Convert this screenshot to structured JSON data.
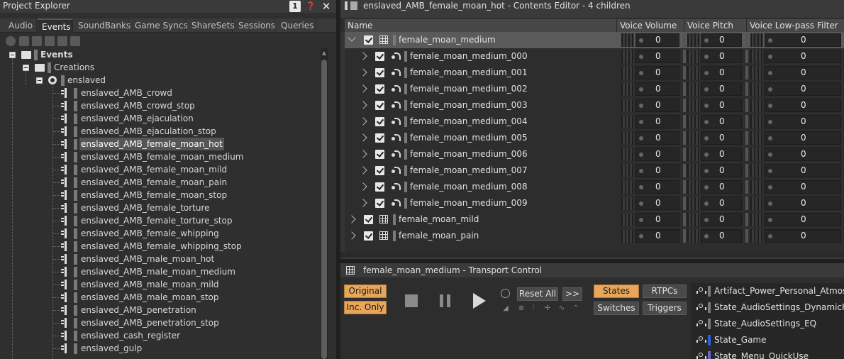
{
  "project_explorer": {
    "title": "Project Explorer",
    "badge": "1",
    "tabs": [
      {
        "label": "Audio"
      },
      {
        "label": "Events"
      },
      {
        "label": "SoundBanks"
      },
      {
        "label": "Game Syncs"
      },
      {
        "label": "ShareSets"
      },
      {
        "label": "Sessions"
      },
      {
        "label": "Queries"
      }
    ],
    "active_tab": "Events",
    "tree": {
      "root": "Events",
      "folder": "Creations",
      "workunit": "enslaved",
      "selected": "enslaved_AMB_female_moan_hot",
      "events": [
        "enslaved_AMB_crowd",
        "enslaved_AMB_crowd_stop",
        "enslaved_AMB_ejaculation",
        "enslaved_AMB_ejaculation_stop",
        "enslaved_AMB_female_moan_hot",
        "enslaved_AMB_female_moan_medium",
        "enslaved_AMB_female_moan_mild",
        "enslaved_AMB_female_moan_pain",
        "enslaved_AMB_female_moan_stop",
        "enslaved_AMB_female_torture",
        "enslaved_AMB_female_torture_stop",
        "enslaved_AMB_female_whipping",
        "enslaved_AMB_female_whipping_stop",
        "enslaved_AMB_male_moan_hot",
        "enslaved_AMB_male_moan_medium",
        "enslaved_AMB_male_moan_mild",
        "enslaved_AMB_male_moan_stop",
        "enslaved_AMB_penetration",
        "enslaved_AMB_penetration_stop",
        "enslaved_cash_register",
        "enslaved_gulp"
      ]
    }
  },
  "contents_editor": {
    "title": "enslaved_AMB_female_moan_hot - Contents Editor - 4 children",
    "columns": [
      "Name",
      "Voice Volume",
      "Voice Pitch",
      "Voice Low-pass Filter"
    ],
    "rows": [
      {
        "name": "female_moan_medium",
        "level": 0,
        "type": "container",
        "expanded": true,
        "selected": true,
        "volume": "0",
        "pitch": "0",
        "lpf": "0"
      },
      {
        "name": "female_moan_medium_000",
        "level": 1,
        "type": "sound",
        "volume": "0",
        "pitch": "0",
        "lpf": "0"
      },
      {
        "name": "female_moan_medium_001",
        "level": 1,
        "type": "sound",
        "volume": "0",
        "pitch": "0",
        "lpf": "0"
      },
      {
        "name": "female_moan_medium_002",
        "level": 1,
        "type": "sound",
        "volume": "0",
        "pitch": "0",
        "lpf": "0"
      },
      {
        "name": "female_moan_medium_003",
        "level": 1,
        "type": "sound",
        "volume": "0",
        "pitch": "0",
        "lpf": "0"
      },
      {
        "name": "female_moan_medium_004",
        "level": 1,
        "type": "sound",
        "volume": "0",
        "pitch": "0",
        "lpf": "0"
      },
      {
        "name": "female_moan_medium_005",
        "level": 1,
        "type": "sound",
        "volume": "0",
        "pitch": "0",
        "lpf": "0"
      },
      {
        "name": "female_moan_medium_006",
        "level": 1,
        "type": "sound",
        "volume": "0",
        "pitch": "0",
        "lpf": "0"
      },
      {
        "name": "female_moan_medium_007",
        "level": 1,
        "type": "sound",
        "volume": "0",
        "pitch": "0",
        "lpf": "0"
      },
      {
        "name": "female_moan_medium_008",
        "level": 1,
        "type": "sound",
        "volume": "0",
        "pitch": "0",
        "lpf": "0"
      },
      {
        "name": "female_moan_medium_009",
        "level": 1,
        "type": "sound",
        "volume": "0",
        "pitch": "0",
        "lpf": "0"
      },
      {
        "name": "female_moan_mild",
        "level": 0,
        "type": "container",
        "volume": "0",
        "pitch": "0",
        "lpf": "0"
      },
      {
        "name": "female_moan_pain",
        "level": 0,
        "type": "container",
        "volume": "0",
        "pitch": "0",
        "lpf": "0"
      }
    ]
  },
  "transport": {
    "title": "female_moan_medium - Transport Control",
    "original_label": "Original",
    "inc_only_label": "Inc. Only",
    "reset_all_label": "Reset All",
    "more_label": ">>",
    "states_label": "States",
    "rtpcs_label": "RTPCs",
    "switches_label": "Switches",
    "triggers_label": "Triggers",
    "state_groups": [
      {
        "name": "Artifact_Power_Personal_Atmosphere",
        "color": "#7a7a7a"
      },
      {
        "name": "State_AudioSettings_DynamicRange",
        "color": "#7a7a7a"
      },
      {
        "name": "State_AudioSettings_EQ",
        "color": "#7a7a7a"
      },
      {
        "name": "State_Game",
        "color": "#2f5fe0"
      },
      {
        "name": "State_Menu_QuickUse",
        "color": "#6a6ad0"
      }
    ]
  },
  "colors": {
    "accent_orange": "#e8a65a",
    "selection": "#5a5a5a"
  }
}
